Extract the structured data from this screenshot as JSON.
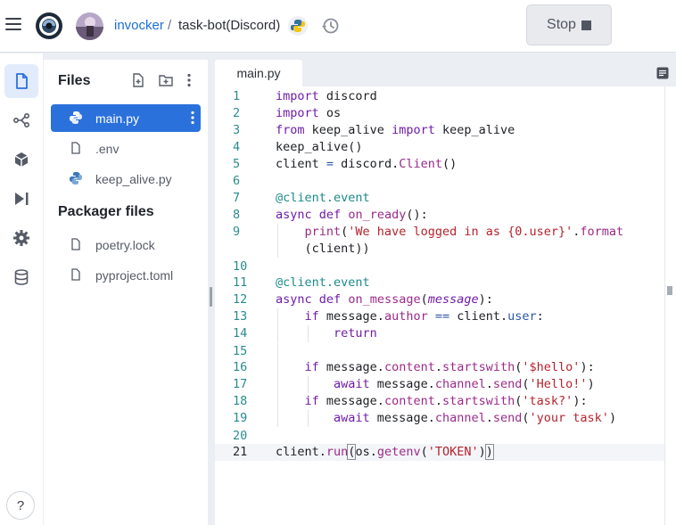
{
  "topbar": {
    "user": "invocker",
    "separator": "/",
    "repl_name": "task-bot(Discord)",
    "stop_label": "Stop"
  },
  "rail": {
    "items": [
      "files-icon",
      "version-control-icon",
      "packages-icon",
      "run-debugger-icon",
      "settings-icon",
      "database-icon"
    ],
    "help_label": "?"
  },
  "files": {
    "title": "Files",
    "items": [
      {
        "name": "main.py",
        "icon": "python-icon",
        "active": true
      },
      {
        "name": ".env",
        "icon": "file-icon",
        "active": false
      },
      {
        "name": "keep_alive.py",
        "icon": "python-icon",
        "active": false
      }
    ],
    "packager_title": "Packager files",
    "packager_items": [
      {
        "name": "poetry.lock",
        "icon": "file-icon"
      },
      {
        "name": "pyproject.toml",
        "icon": "file-icon"
      }
    ]
  },
  "editor": {
    "tab": "main.py",
    "current_line": 21,
    "lines": [
      {
        "n": "1",
        "text": "import discord"
      },
      {
        "n": "2",
        "text": "import os"
      },
      {
        "n": "3",
        "text": "from keep_alive import keep_alive"
      },
      {
        "n": "4",
        "text": "keep_alive()"
      },
      {
        "n": "5",
        "text": "client = discord.Client()"
      },
      {
        "n": "6",
        "text": ""
      },
      {
        "n": "7",
        "text": "@client.event"
      },
      {
        "n": "8",
        "text": "async def on_ready():"
      },
      {
        "n": "9",
        "text": "    print('We have logged in as {0.user}'.format"
      },
      {
        "n": "",
        "text": "    (client))"
      },
      {
        "n": "10",
        "text": ""
      },
      {
        "n": "11",
        "text": "@client.event"
      },
      {
        "n": "12",
        "text": "async def on_message(message):"
      },
      {
        "n": "13",
        "text": "    if message.author == client.user:"
      },
      {
        "n": "14",
        "text": "        return"
      },
      {
        "n": "15",
        "text": ""
      },
      {
        "n": "16",
        "text": "    if message.content.startswith('$hello'):"
      },
      {
        "n": "17",
        "text": "        await message.channel.send('Hello!')"
      },
      {
        "n": "18",
        "text": "    if message.content.startswith('task?'):"
      },
      {
        "n": "19",
        "text": "        await message.channel.send('your task')"
      },
      {
        "n": "20",
        "text": ""
      },
      {
        "n": "21",
        "text": "client.run(os.getenv('TOKEN'))"
      }
    ]
  },
  "colors": {
    "accent": "#2b71dc",
    "keyword": "#6f1ca8",
    "string": "#b5232d",
    "line_number": "#2a8b8e"
  }
}
